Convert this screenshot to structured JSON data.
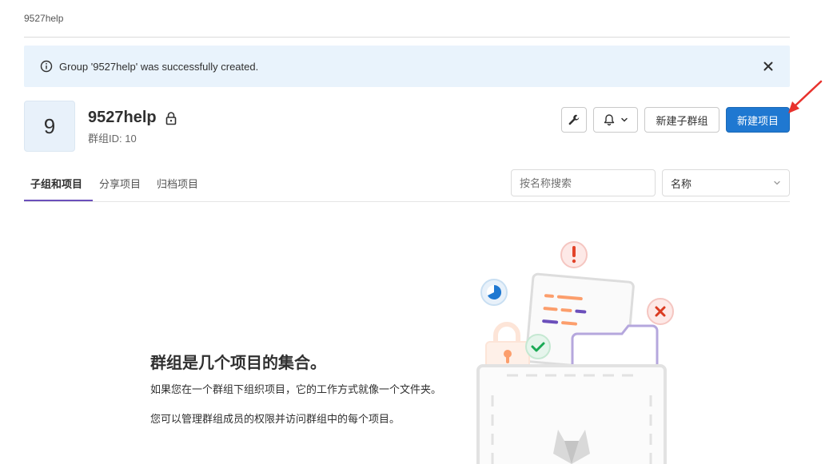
{
  "breadcrumb": "9527help",
  "alert": {
    "message": "Group '9527help' was successfully created.",
    "icon": "info-icon",
    "close_icon": "close-icon"
  },
  "group": {
    "avatar_letter": "9",
    "name": "9527help",
    "id_label": "群组ID: 10",
    "lock_icon": "lock-icon"
  },
  "header_actions": {
    "settings_icon": "wrench-icon",
    "notification_icon": "bell-icon",
    "new_subgroup": "新建子群组",
    "new_project": "新建项目"
  },
  "tabs": [
    {
      "label": "子组和项目",
      "active": true
    },
    {
      "label": "分享项目",
      "active": false
    },
    {
      "label": "归档项目",
      "active": false
    }
  ],
  "filter": {
    "search_placeholder": "按名称搜索",
    "sort_selected": "名称"
  },
  "empty_state": {
    "title": "群组是几个项目的集合。",
    "line1": "如果您在一个群组下组织项目，它的工作方式就像一个文件夹。",
    "line2": "您可以管理群组成员的权限并访问群组中的每个项目。"
  },
  "colors": {
    "primary": "#1f78d1",
    "tab_active": "#6b4fbb",
    "alert_bg": "#e9f3fc"
  }
}
